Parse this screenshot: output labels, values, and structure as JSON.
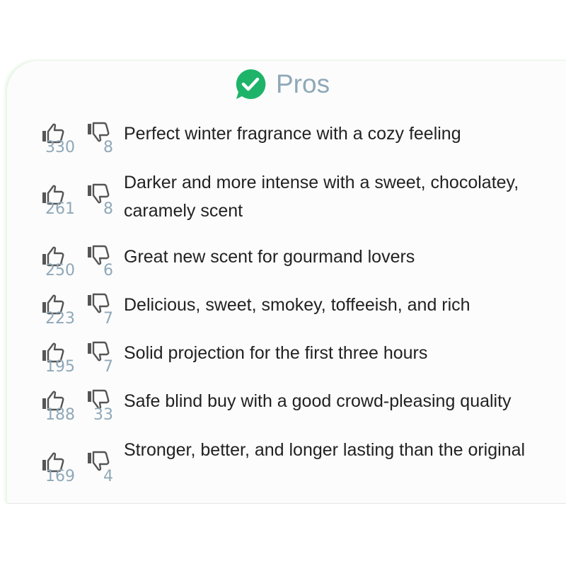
{
  "header": {
    "title": "Pros",
    "icon": "check-badge-icon",
    "accent_color": "#1db46a"
  },
  "items": [
    {
      "text": "Perfect winter fragrance with a cozy feeling",
      "likes": "330",
      "dislikes": "8"
    },
    {
      "text": "Darker and more intense with a sweet, chocolatey, caramely scent",
      "likes": "261",
      "dislikes": "8"
    },
    {
      "text": "Great new scent for gourmand lovers",
      "likes": "250",
      "dislikes": "6"
    },
    {
      "text": "Delicious, sweet, smokey, toffeeish, and rich",
      "likes": "223",
      "dislikes": "7"
    },
    {
      "text": "Solid projection for the first three hours",
      "likes": "195",
      "dislikes": "7"
    },
    {
      "text": "Safe blind buy with a good crowd-pleasing quality",
      "likes": "188",
      "dislikes": "33"
    },
    {
      "text": "Stronger, better, and longer lasting than the original",
      "likes": "169",
      "dislikes": "4"
    }
  ]
}
